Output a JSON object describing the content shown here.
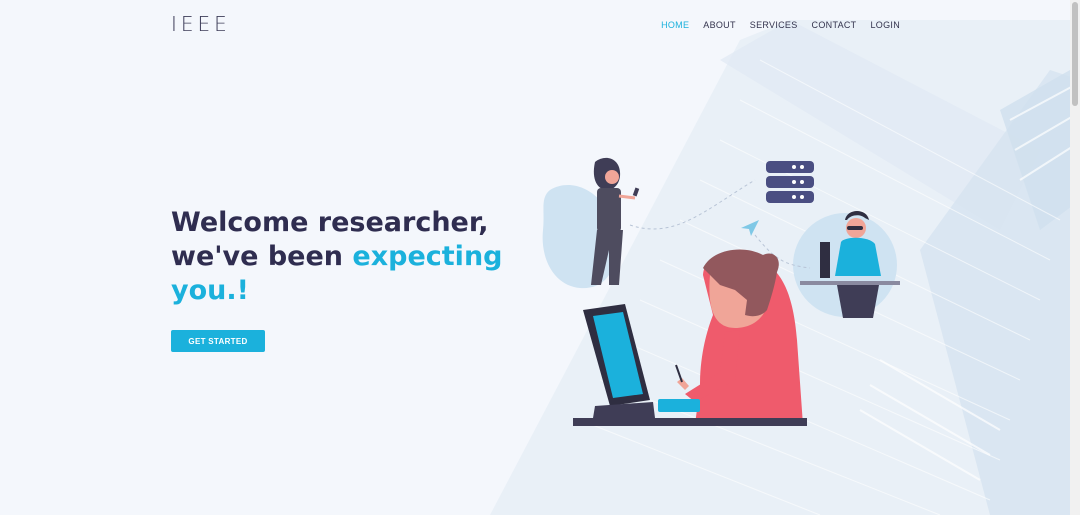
{
  "brand": {
    "logo": "IEEE"
  },
  "nav": {
    "items": [
      {
        "label": "HOME",
        "active": true
      },
      {
        "label": "ABOUT",
        "active": false
      },
      {
        "label": "SERVICES",
        "active": false
      },
      {
        "label": "CONTACT",
        "active": false
      },
      {
        "label": "LOGIN",
        "active": false
      }
    ]
  },
  "hero": {
    "title_line1": "Welcome researcher,",
    "title_line2_start": "we've been ",
    "title_accent_1": "expecting",
    "title_accent_2": "you.!",
    "cta_label": "GET STARTED"
  },
  "colors": {
    "accent": "#1bb1dc",
    "heading": "#2f2d50",
    "background": "#f4f7fc"
  },
  "icons": [
    "server-stack-icon",
    "paper-plane-icon"
  ]
}
